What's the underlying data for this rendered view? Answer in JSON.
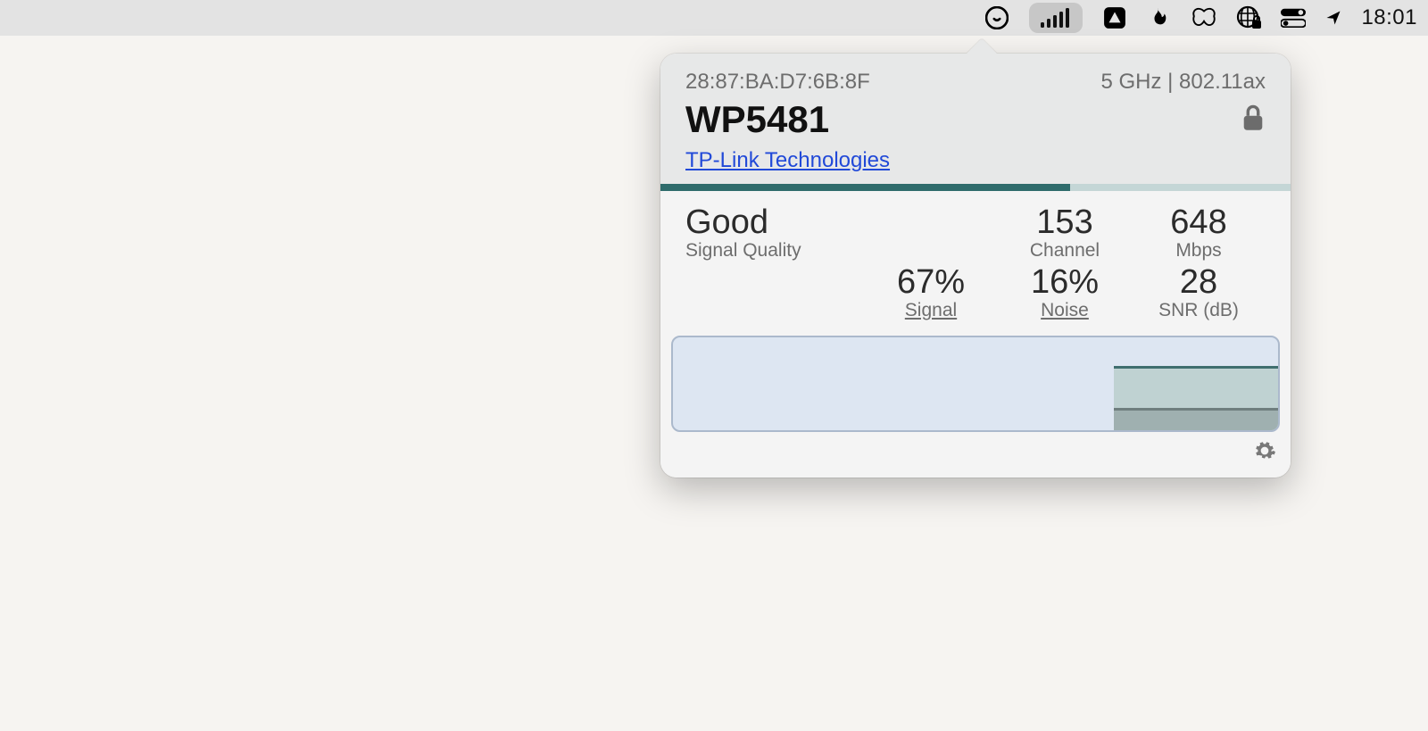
{
  "menubar": {
    "clock": "18:01"
  },
  "network": {
    "mac": "28:87:BA:D7:6B:8F",
    "band_mode": "5 GHz | 802.11ax",
    "ssid": "WP5481",
    "vendor": "TP-Link Technologies",
    "progress_pct": 65
  },
  "stats": {
    "quality_value": "Good",
    "quality_label": "Signal Quality",
    "channel_value": "153",
    "channel_label": "Channel",
    "mbps_value": "648",
    "mbps_label": "Mbps",
    "signal_value": "67%",
    "signal_label": "Signal",
    "noise_value": "16%",
    "noise_label": "Noise",
    "snr_value": "28",
    "snr_label": "SNR (dB)"
  },
  "chart_data": {
    "type": "area",
    "x_range_seconds": 60,
    "data_start_fraction": 0.73,
    "series": [
      {
        "name": "Signal",
        "value_pct": 67
      },
      {
        "name": "Noise",
        "value_pct": 16
      }
    ]
  }
}
